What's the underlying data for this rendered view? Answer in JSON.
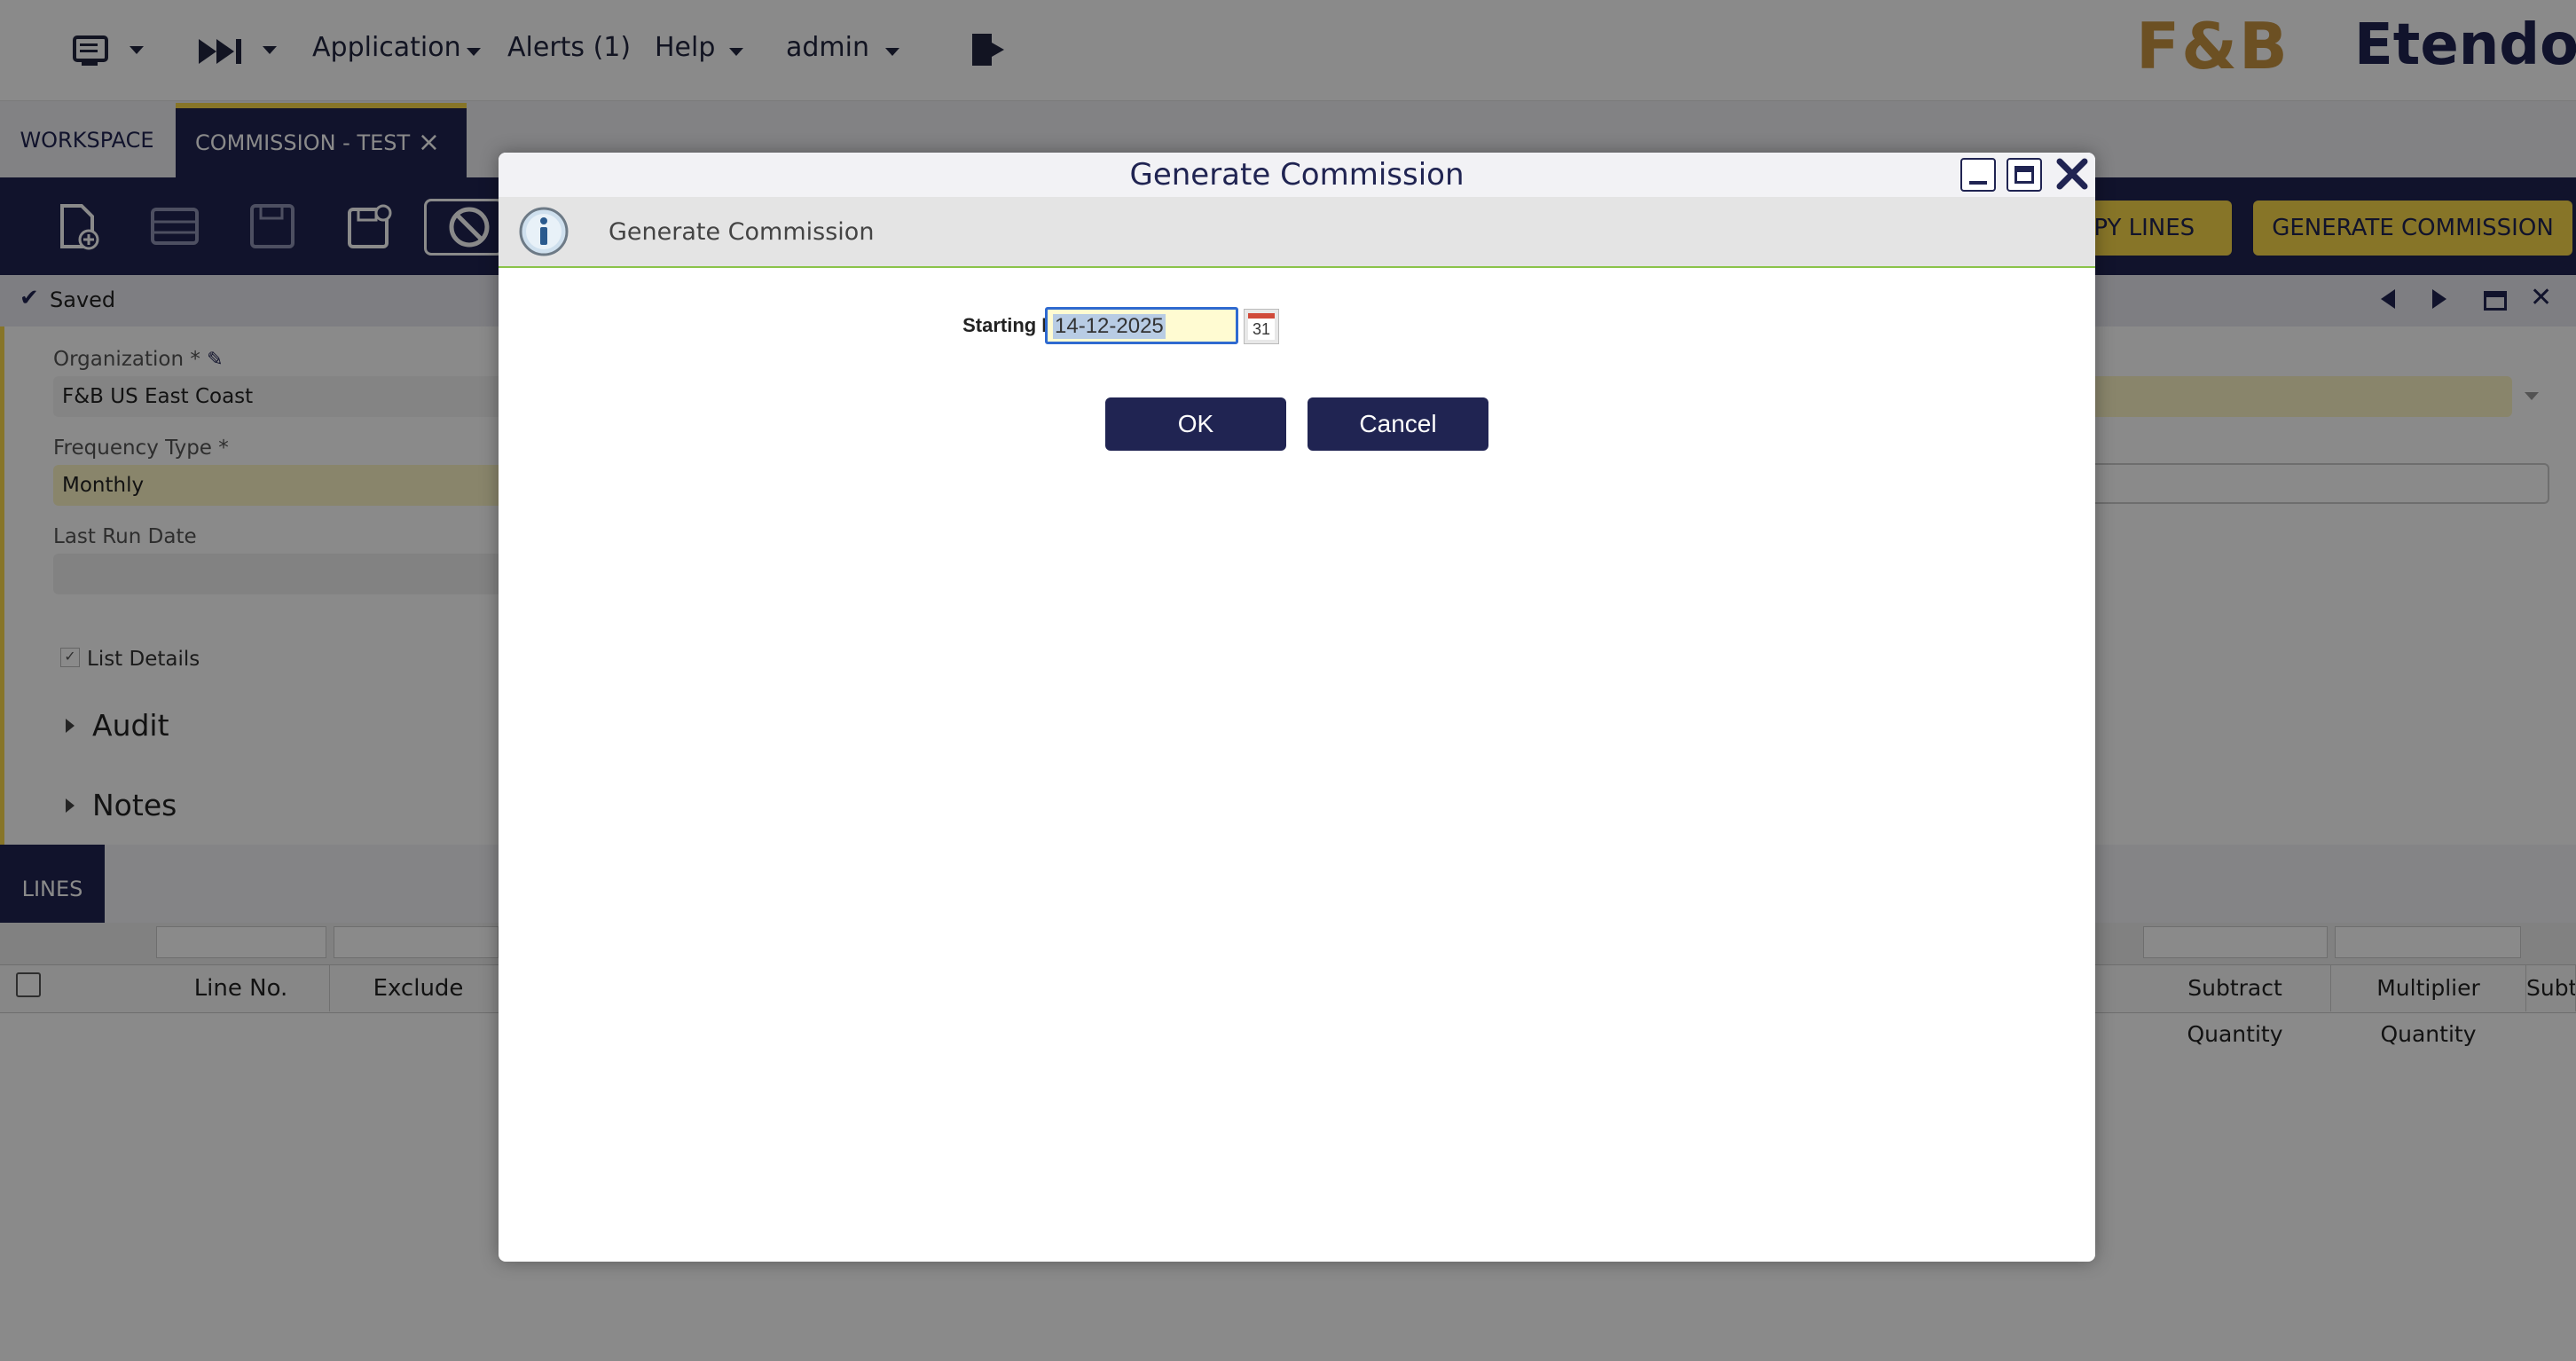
{
  "topbar": {
    "menu_application": "Application",
    "menu_alerts": "Alerts (1)",
    "menu_help": "Help",
    "menu_user": "admin",
    "logo_brand": "F&B",
    "logo_product": "Etendo"
  },
  "tabs": {
    "workspace": "WORKSPACE",
    "active": "COMMISSION - TEST",
    "close_glyph": "×"
  },
  "toolbar": {
    "copy_lines": "COPY LINES",
    "generate_commission": "GENERATE COMMISSION"
  },
  "status": {
    "text": "Saved"
  },
  "form": {
    "organization_label": "Organization *",
    "organization_value": "F&B US East Coast",
    "frequency_label": "Frequency Type *",
    "frequency_value": "Monthly",
    "last_run_label": "Last Run Date",
    "list_details_label": "List Details",
    "audit_label": "Audit",
    "notes_label": "Notes"
  },
  "lines": {
    "tab_label": "LINES",
    "columns": [
      "Line No.",
      "Exclude",
      "Subtract Quantity",
      "Multiplier Quantity",
      "Subt"
    ]
  },
  "dialog": {
    "title": "Generate Commission",
    "info_text": "Generate Commission",
    "starting_date_label": "Starting Date",
    "starting_date_value": "14-12-2025",
    "calendar_text": "31",
    "ok_label": "OK",
    "cancel_label": "Cancel"
  },
  "colors": {
    "navy": "#202452",
    "yellow_button": "#fad84a",
    "required_field": "#fdf6c6",
    "success_line": "#8bc34a"
  }
}
